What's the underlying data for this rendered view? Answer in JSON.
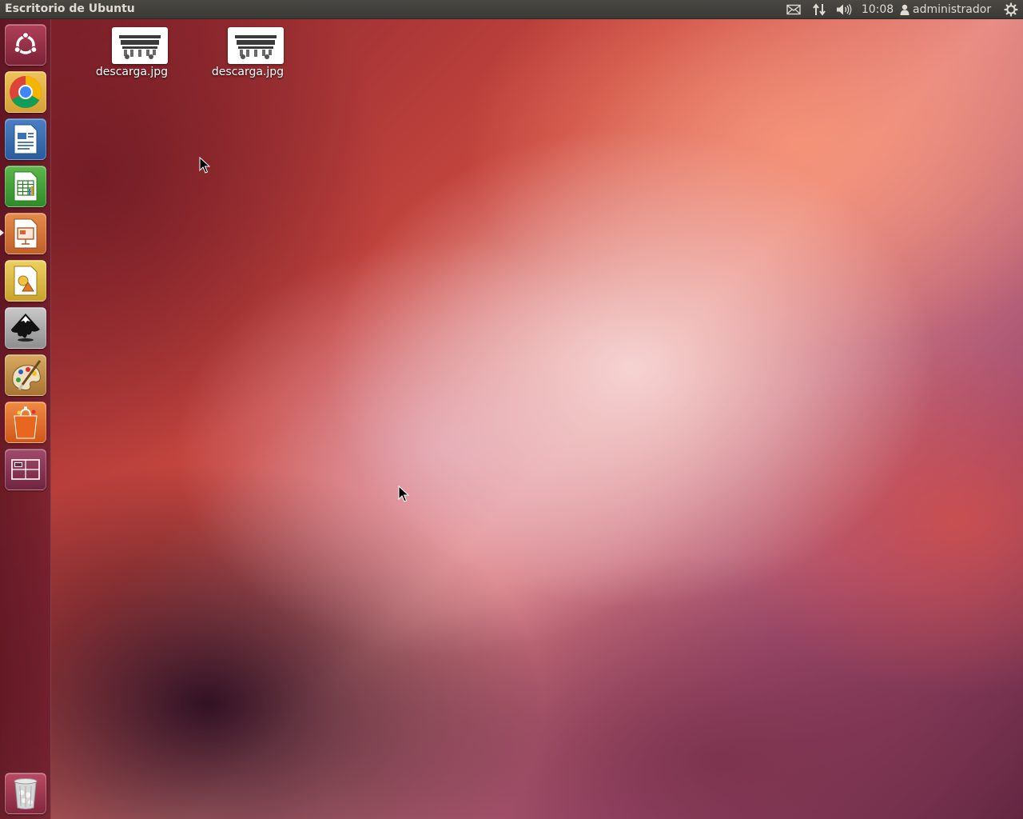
{
  "top_panel": {
    "title": "Escritorio de Ubuntu",
    "clock": "10:08",
    "user": "administrador",
    "indicators": [
      "mail-icon",
      "network-icon",
      "sound-icon",
      "session-gear-icon"
    ]
  },
  "launcher": {
    "items": [
      {
        "name": "dash-home",
        "icon": "ubuntu-logo-icon"
      },
      {
        "name": "google-chrome",
        "icon": "chrome-icon"
      },
      {
        "name": "libreoffice-writer",
        "icon": "writer-icon"
      },
      {
        "name": "libreoffice-calc",
        "icon": "calc-icon"
      },
      {
        "name": "libreoffice-impress",
        "icon": "impress-icon",
        "running": true
      },
      {
        "name": "libreoffice-draw",
        "icon": "draw-icon"
      },
      {
        "name": "inkscape",
        "icon": "inkscape-icon"
      },
      {
        "name": "mypaint",
        "icon": "paint-palette-icon"
      },
      {
        "name": "ubuntu-software-center",
        "icon": "shopping-bag-icon"
      },
      {
        "name": "workspace-switcher",
        "icon": "workspaces-icon"
      },
      {
        "name": "trash",
        "icon": "trash-icon"
      }
    ]
  },
  "desktop": {
    "icons": [
      {
        "label": "descarga.jpg"
      },
      {
        "label": "descarga.jpg"
      }
    ]
  },
  "colors": {
    "panel_bg": "#3b3a36",
    "panel_text": "#dfdbd2",
    "launcher_bg": "#6e1c2c",
    "wallpaper_accent": "#e58a86"
  }
}
